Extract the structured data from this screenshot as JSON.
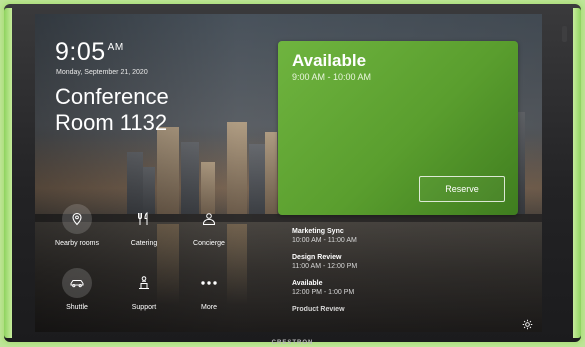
{
  "clock": {
    "time": "9:05",
    "ampm": "AM",
    "date": "Monday, September 21, 2020"
  },
  "room": {
    "line1": "Conference",
    "line2": "Room 1132"
  },
  "tiles": [
    {
      "label": "Nearby rooms",
      "icon": "location-pin-icon"
    },
    {
      "label": "Catering",
      "icon": "fork-knife-icon"
    },
    {
      "label": "Concierge",
      "icon": "concierge-bell-icon"
    },
    {
      "label": "Shuttle",
      "icon": "car-icon"
    },
    {
      "label": "Support",
      "icon": "support-person-icon"
    },
    {
      "label": "More",
      "icon": "more-dots-icon"
    }
  ],
  "status_card": {
    "status": "Available",
    "time_range": "9:00 AM - 10:00 AM",
    "reserve_label": "Reserve",
    "color": "#5fa534"
  },
  "agenda": [
    {
      "title": "Marketing Sync",
      "time": "10:00 AM - 11:00 AM"
    },
    {
      "title": "Design Review",
      "time": "11:00 AM - 12:00 PM"
    },
    {
      "title": "Available",
      "time": "12:00 PM - 1:00 PM"
    },
    {
      "title": "Product Review",
      "time": ""
    }
  ],
  "brand": "CRESTRON",
  "settings": {
    "icon": "gear-icon"
  },
  "accent_glow": "#a9dd77"
}
